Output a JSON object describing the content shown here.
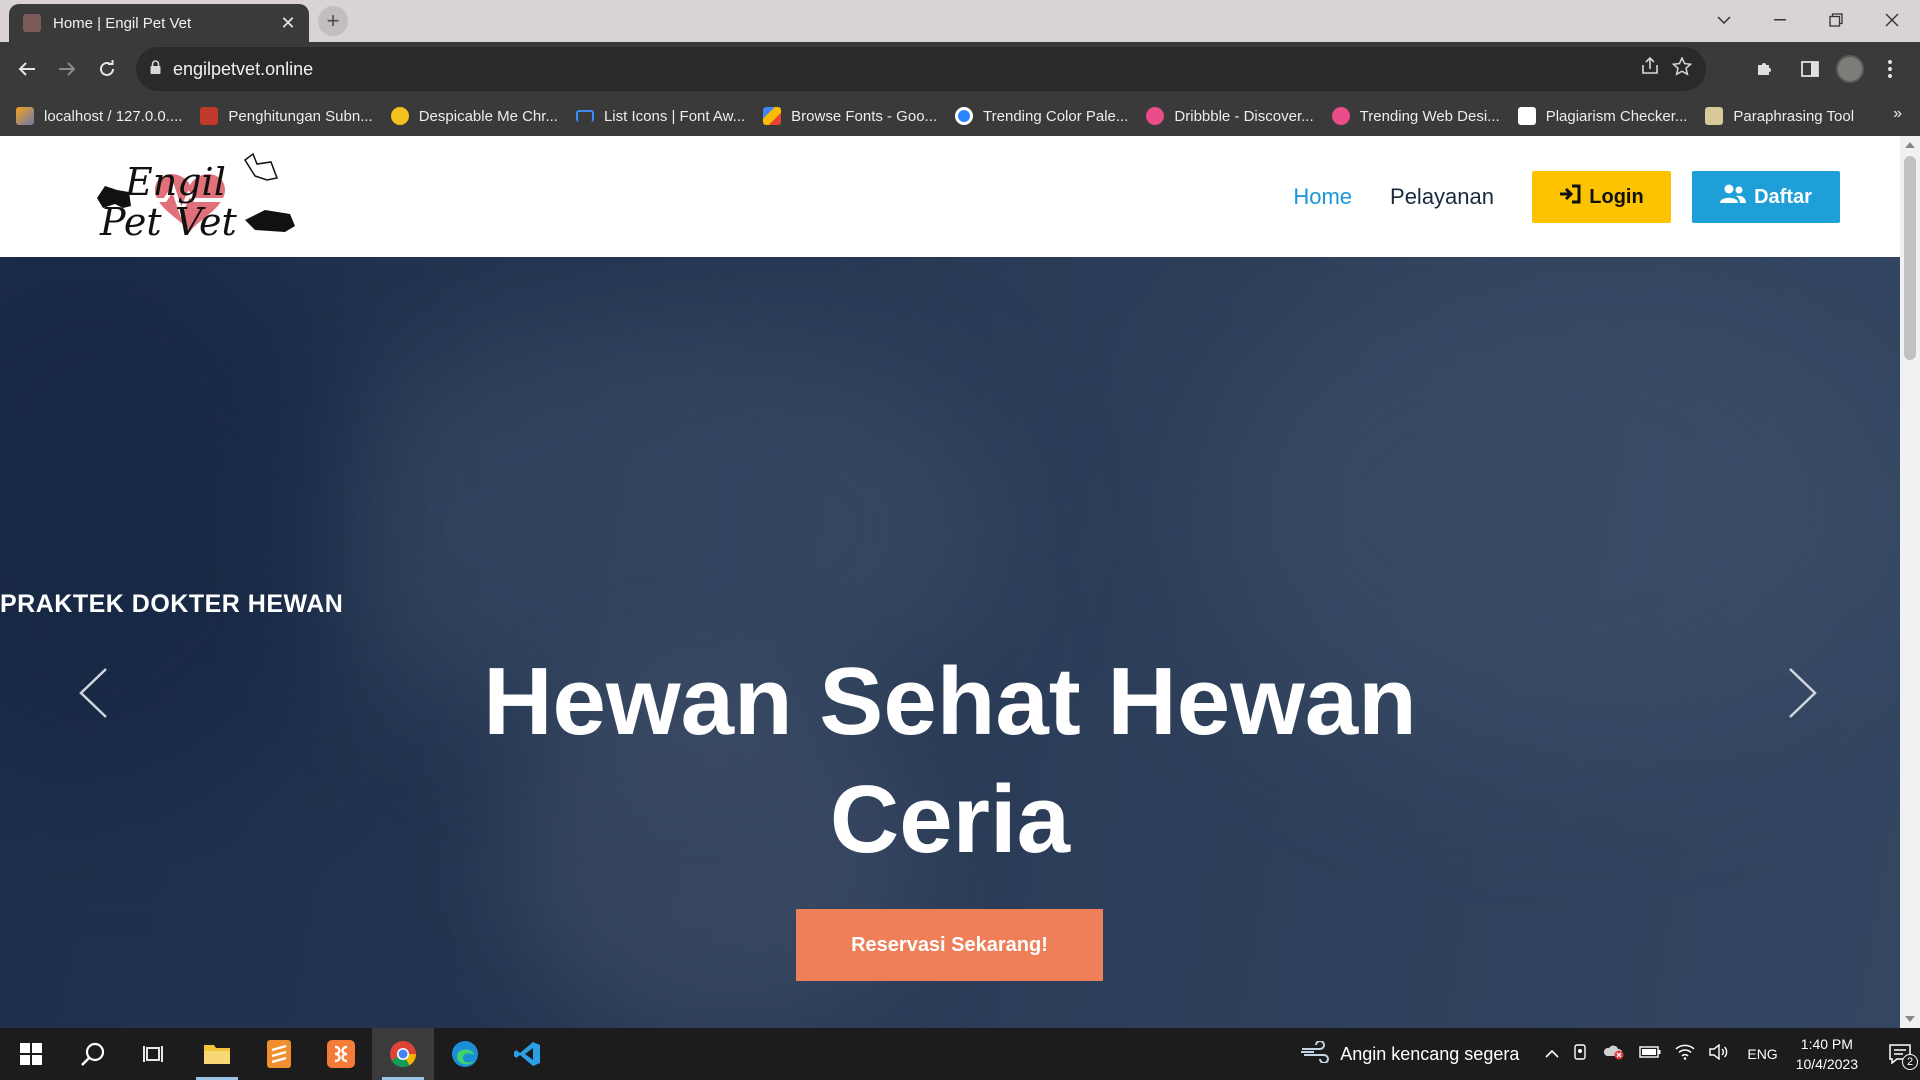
{
  "browser": {
    "tab": {
      "title": "Home | Engil Pet Vet"
    },
    "url": "engilpetvet.online",
    "bookmarks": [
      {
        "label": "localhost / 127.0.0....",
        "icon": "phpmyadmin-icon",
        "color": "#f6a21b"
      },
      {
        "label": "Penghitungan Subn...",
        "icon": "rsw-icon",
        "color": "#c0392b"
      },
      {
        "label": "Despicable Me Chr...",
        "icon": "minion-icon",
        "color": "#f2c41b"
      },
      {
        "label": "List Icons | Font Aw...",
        "icon": "flag-icon",
        "color": "#3e8ef7"
      },
      {
        "label": "Browse Fonts - Goo...",
        "icon": "google-fonts-icon",
        "color": "#4285f4"
      },
      {
        "label": "Trending Color Pale...",
        "icon": "coolors-icon",
        "color": "#2a84ff"
      },
      {
        "label": "Dribbble - Discover...",
        "icon": "dribbble-icon",
        "color": "#ea4c89"
      },
      {
        "label": "Trending Web Desi...",
        "icon": "dribbble-icon",
        "color": "#ea4c89"
      },
      {
        "label": "Plagiarism Checker...",
        "icon": "sst-icon",
        "color": "#ffffff"
      },
      {
        "label": "Paraphrasing Tool",
        "icon": "paraphrase-icon",
        "color": "#d8c89a"
      }
    ]
  },
  "site": {
    "logo_text": "Engil Pet Vet",
    "nav": {
      "home": "Home",
      "services": "Pelayanan",
      "login": "Login",
      "register": "Daftar"
    },
    "hero": {
      "eyebrow": "PRAKTEK DOKTER HEWAN",
      "title": "Hewan Sehat Hewan Ceria",
      "cta": "Reservasi Sekarang!"
    },
    "colors": {
      "accent_blue": "#1b95d6",
      "login_yellow": "#fdc200",
      "register_blue": "#1e9fd8",
      "cta_orange": "#ef7f59",
      "hero_overlay": "#243551"
    }
  },
  "taskbar": {
    "weather": "Angin kencang segera",
    "language": "ENG",
    "time": "1:40 PM",
    "date": "10/4/2023",
    "notification_count": "2"
  }
}
